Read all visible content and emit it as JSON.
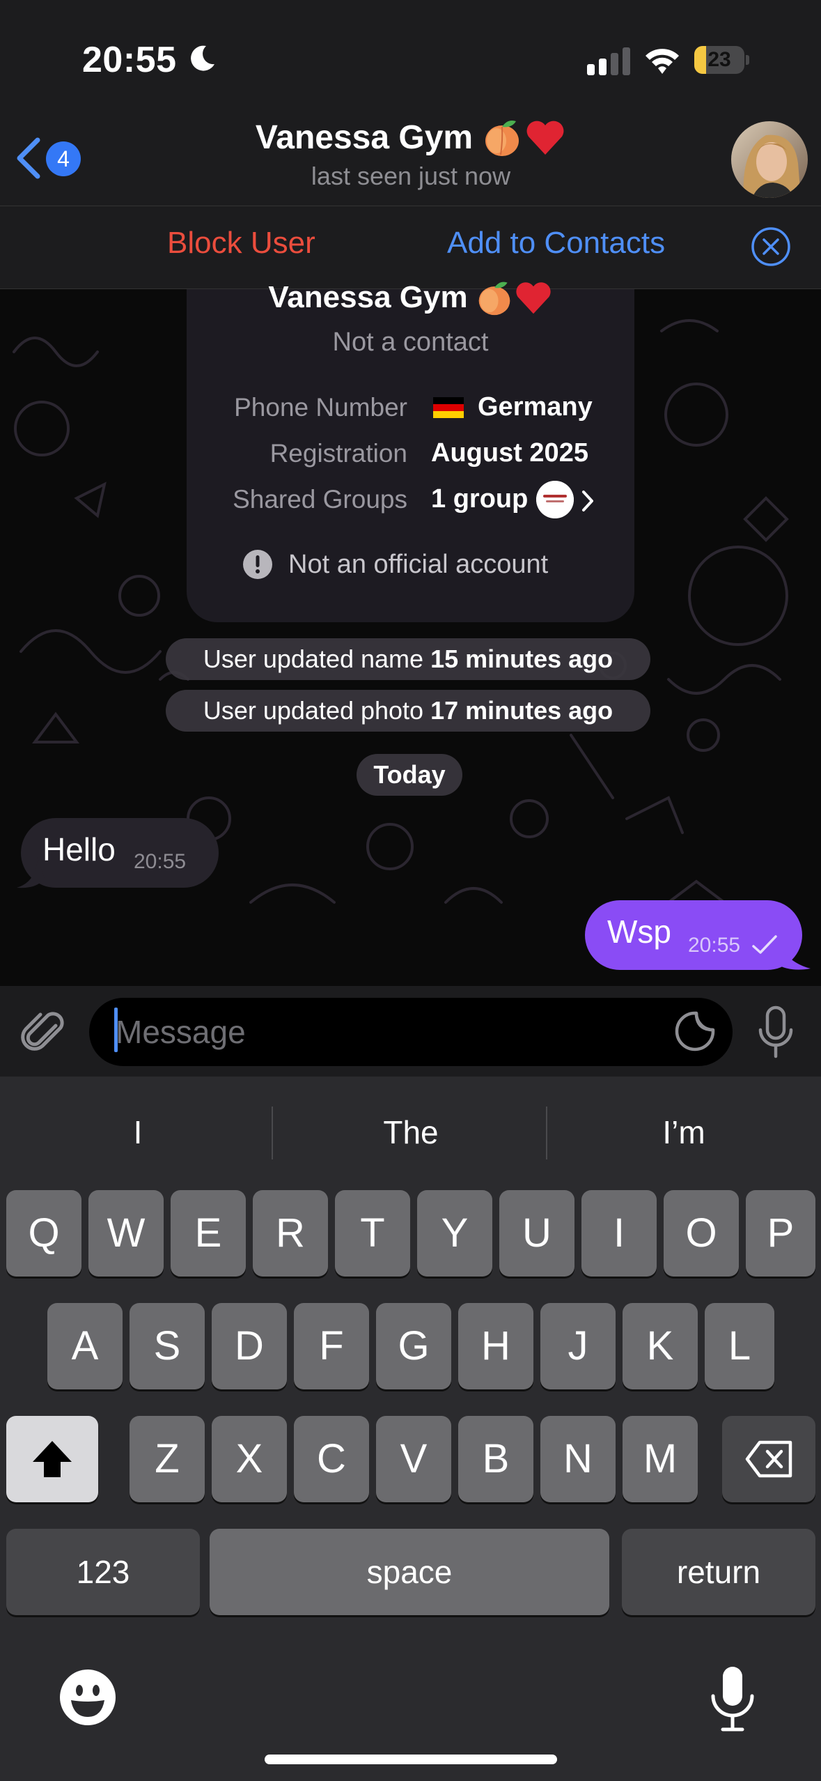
{
  "status_bar": {
    "time": "20:55",
    "battery": "23",
    "battery_level": 0.23
  },
  "header": {
    "unread_count": "4",
    "title": "Vanessa Gym",
    "subtitle": "last seen just now"
  },
  "action_bar": {
    "block_label": "Block User",
    "add_label": "Add to Contacts"
  },
  "info_card": {
    "name": "Vanessa Gym",
    "status": "Not a contact",
    "rows": [
      {
        "label": "Phone Number",
        "value": "Germany"
      },
      {
        "label": "Registration",
        "value": "August 2025"
      },
      {
        "label": "Shared Groups",
        "value": "1 group"
      }
    ],
    "warning": "Not an official account"
  },
  "service_messages": [
    {
      "text": "User updated name ",
      "bold": "15 minutes ago"
    },
    {
      "text": "User updated photo ",
      "bold": "17 minutes ago"
    }
  ],
  "date_separator": "Today",
  "messages": [
    {
      "direction": "incoming",
      "text": "Hello",
      "time": "20:55"
    },
    {
      "direction": "outgoing",
      "text": "Wsp",
      "time": "20:55"
    }
  ],
  "input": {
    "placeholder": "Message"
  },
  "keyboard": {
    "suggestions": [
      "I",
      "The",
      "I’m"
    ],
    "row1": [
      "Q",
      "W",
      "E",
      "R",
      "T",
      "Y",
      "U",
      "I",
      "O",
      "P"
    ],
    "row2": [
      "A",
      "S",
      "D",
      "F",
      "G",
      "H",
      "J",
      "K",
      "L"
    ],
    "row3": [
      "Z",
      "X",
      "C",
      "V",
      "B",
      "N",
      "M"
    ],
    "numbers_label": "123",
    "space_label": "space",
    "return_label": "return"
  },
  "colors": {
    "accent": "#4f8ff7",
    "danger": "#eb4d3d",
    "outgoing_bubble": "#8a4cf5",
    "incoming_bubble": "#26232b"
  }
}
